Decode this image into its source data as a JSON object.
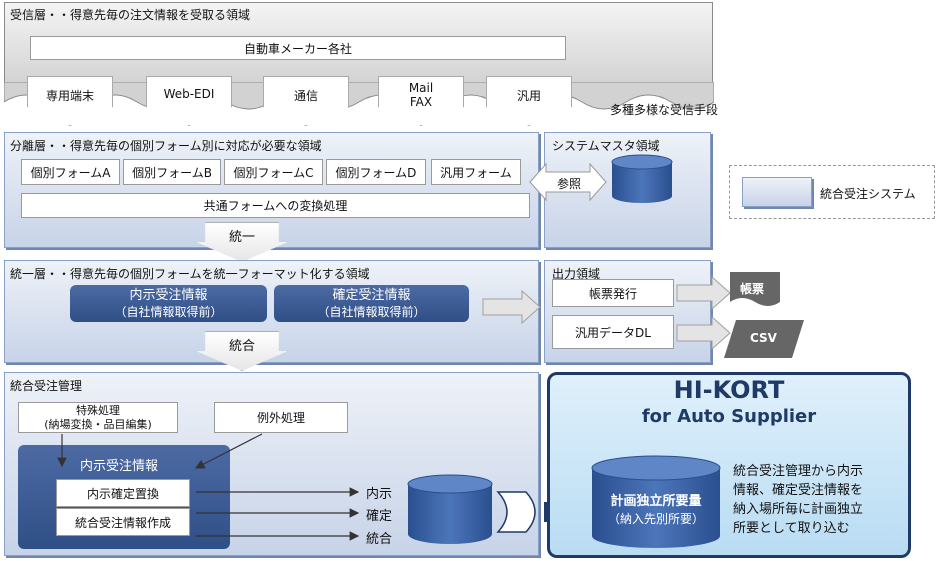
{
  "receive_layer": {
    "title": "受信層・・得意先毎の注文情報を受取る領域",
    "customers": "自動車メーカー各社",
    "channels": [
      "専用端末",
      "Web-EDI",
      "通信",
      "Mail",
      "FAX",
      "汎用"
    ],
    "channels_caption": "多種多様な受信手段"
  },
  "separation_layer": {
    "title": "分離層・・得意先毎の個別フォーム別に対応が必要な領域",
    "forms": [
      "個別フォームA",
      "個別フォームB",
      "個別フォームC",
      "個別フォームD",
      "汎用フォーム"
    ],
    "conversion": "共通フォームへの変換処理",
    "arrow_label": "統一"
  },
  "master_area": {
    "title": "システムマスタ領域",
    "reference": "参照"
  },
  "legend": {
    "label": "統合受注システム"
  },
  "unified_layer": {
    "title": "統一層・・得意先毎の個別フォームを統一フォーマット化する領域",
    "tentative": {
      "main": "内示受注情報",
      "sub": "（自社情報取得前）"
    },
    "confirmed": {
      "main": "確定受注情報",
      "sub": "（自社情報取得前）"
    },
    "arrow_label": "統合"
  },
  "output_area": {
    "title": "出力領域",
    "items": [
      "帳票発行",
      "汎用データDL"
    ],
    "outputs": [
      "帳票",
      "CSV"
    ]
  },
  "integrated_mgmt": {
    "title": "統合受注管理",
    "special_line1": "特殊処理",
    "special_line2": "(納場変換・品目編集)",
    "exception": "例外処理",
    "info_box_title": "内示受注情報",
    "steps": [
      "内示確定置換",
      "統合受注情報作成"
    ],
    "flows": [
      "内示",
      "確定",
      "統合"
    ]
  },
  "hikort": {
    "title": "HI-KORT",
    "subtitle": "for Auto Supplier",
    "db_main": "計画独立所要量",
    "db_sub": "（納入先別所要）",
    "description": [
      "統合受注管理から内示",
      "情報、確定受注情報を",
      "納入場所毎に計画独立",
      "所要として取り込む"
    ]
  }
}
